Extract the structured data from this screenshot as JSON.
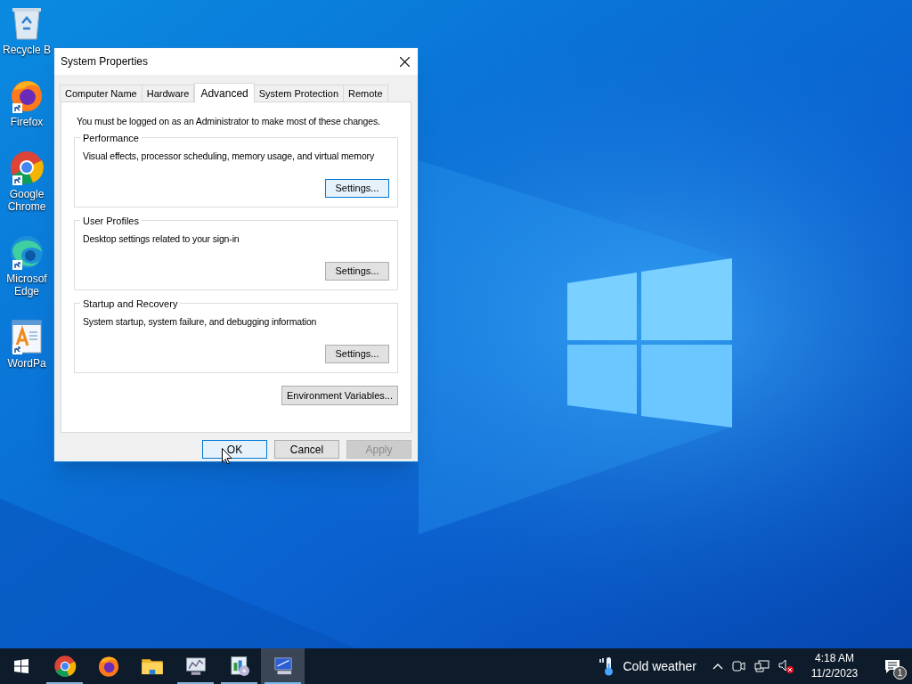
{
  "desktop_icons": [
    {
      "kind": "recycle",
      "label": "Recycle B"
    },
    {
      "kind": "firefox",
      "label": "Firefox"
    },
    {
      "kind": "chrome",
      "label": "Google Chrome"
    },
    {
      "kind": "edge",
      "label": "Microsof Edge"
    },
    {
      "kind": "wordpad",
      "label": "WordPa"
    }
  ],
  "dialog": {
    "title": "System Properties",
    "tabs": [
      {
        "label": "Computer Name",
        "selected": false
      },
      {
        "label": "Hardware",
        "selected": false
      },
      {
        "label": "Advanced",
        "selected": true
      },
      {
        "label": "System Protection",
        "selected": false
      },
      {
        "label": "Remote",
        "selected": false
      }
    ],
    "notice": "You must be logged on as an Administrator to make most of these changes.",
    "groups": [
      {
        "title": "Performance",
        "description": "Visual effects, processor scheduling, memory usage, and virtual memory",
        "button": "Settings...",
        "focused": true
      },
      {
        "title": "User Profiles",
        "description": "Desktop settings related to your sign-in",
        "button": "Settings...",
        "focused": false
      },
      {
        "title": "Startup and Recovery",
        "description": "System startup, system failure, and debugging information",
        "button": "Settings...",
        "focused": false
      }
    ],
    "env_button": "Environment Variables...",
    "buttons": [
      {
        "label": "OK",
        "kind": "default"
      },
      {
        "label": "Cancel",
        "kind": "normal"
      },
      {
        "label": "Apply",
        "kind": "disabled"
      }
    ]
  },
  "taskbar": {
    "apps": [
      {
        "kind": "chrome",
        "running": true,
        "active": false
      },
      {
        "kind": "firefox",
        "running": false,
        "active": false
      },
      {
        "kind": "folder",
        "running": false,
        "active": false
      },
      {
        "kind": "monitor",
        "running": true,
        "active": false
      },
      {
        "kind": "control",
        "running": true,
        "active": false
      },
      {
        "kind": "system",
        "running": true,
        "active": true
      }
    ],
    "weather": "Cold weather",
    "time": "4:18 AM",
    "date": "11/2/2023",
    "notifications": "1"
  }
}
